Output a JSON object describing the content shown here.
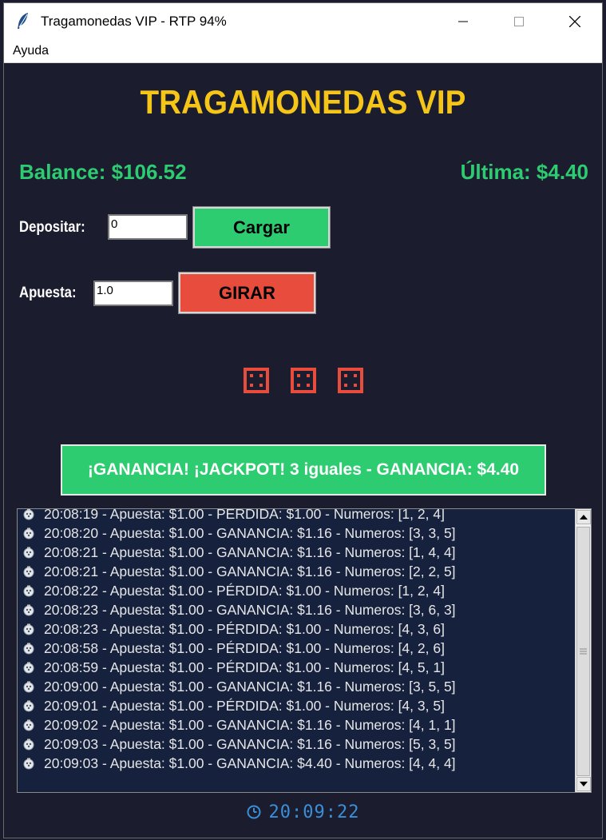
{
  "window": {
    "title": "Tragamonedas VIP - RTP 94%"
  },
  "menu": {
    "items": [
      "Ayuda"
    ]
  },
  "app": {
    "title": "TRAGAMONEDAS VIP",
    "balance": "Balance: $106.52",
    "last_win": "Última: $4.40"
  },
  "deposit": {
    "label": "Depositar:",
    "value": "0",
    "button": "Cargar"
  },
  "bet": {
    "label": "Apuesta:",
    "value": "1.0",
    "button": "GIRAR"
  },
  "reels": {
    "icon": "die-four-icon",
    "count": 3
  },
  "result_banner": "¡GANANCIA! ¡JACKPOT! 3 iguales - GANANCIA: $4.40",
  "history": [
    "20:08:19 - Apuesta: $1.00 - PÉRDIDA: $1.00 - Numeros: [1, 2, 4]",
    "20:08:20 - Apuesta: $1.00 - GANANCIA: $1.16 - Numeros: [3, 3, 5]",
    "20:08:21 - Apuesta: $1.00 - GANANCIA: $1.16 - Numeros: [1, 4, 4]",
    "20:08:21 - Apuesta: $1.00 - GANANCIA: $1.16 - Numeros: [2, 2, 5]",
    "20:08:22 - Apuesta: $1.00 - PÉRDIDA: $1.00 - Numeros: [1, 2, 4]",
    "20:08:23 - Apuesta: $1.00 - GANANCIA: $1.16 - Numeros: [3, 6, 3]",
    "20:08:23 - Apuesta: $1.00 - PÉRDIDA: $1.00 - Numeros: [4, 3, 6]",
    "20:08:58 - Apuesta: $1.00 - PÉRDIDA: $1.00 - Numeros: [4, 2, 6]",
    "20:08:59 - Apuesta: $1.00 - PÉRDIDA: $1.00 - Numeros: [4, 5, 1]",
    "20:09:00 - Apuesta: $1.00 - GANANCIA: $1.16 - Numeros: [3, 5, 5]",
    "20:09:01 - Apuesta: $1.00 - PÉRDIDA: $1.00 - Numeros: [4, 3, 5]",
    "20:09:02 - Apuesta: $1.00 - GANANCIA: $1.16 - Numeros: [4, 1, 1]",
    "20:09:03 - Apuesta: $1.00 - GANANCIA: $1.16 - Numeros: [5, 3, 5]",
    "20:09:03 - Apuesta: $1.00 - GANANCIA: $4.40 - Numeros: [4, 4, 4]"
  ],
  "clock": "20:09:22",
  "colors": {
    "background": "#1b1c2e",
    "title_gold": "#f5c518",
    "money_green": "#2ecc71",
    "spin_red": "#e74c3c",
    "log_bg": "#16213e",
    "clock_blue": "#3a8fd9"
  }
}
